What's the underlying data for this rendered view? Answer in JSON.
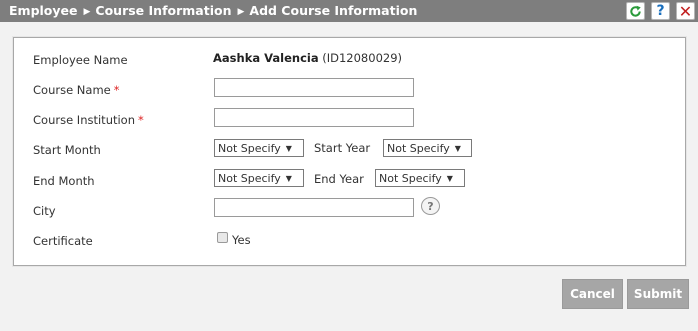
{
  "header": {
    "breadcrumb": [
      "Employee",
      "Course Information",
      "Add Course Information"
    ],
    "refresh_icon": "refresh-icon",
    "help_label": "?",
    "close_label": "✕"
  },
  "form": {
    "employee_name_label": "Employee Name",
    "employee_name": "Aashka Valencia",
    "employee_id": "(ID12080029)",
    "course_name_label": "Course Name",
    "course_name_value": "",
    "course_institution_label": "Course Institution",
    "course_institution_value": "",
    "required_marker": "*",
    "start_month_label": "Start Month",
    "start_month_value": "Not Specify",
    "start_year_label": "Start Year",
    "start_year_value": "Not Specify",
    "end_month_label": "End Month",
    "end_month_value": "Not Specify",
    "end_year_label": "End Year",
    "end_year_value": "Not Specify",
    "city_label": "City",
    "city_value": "",
    "city_help": "?",
    "certificate_label": "Certificate",
    "certificate_option": "Yes",
    "certificate_checked": false
  },
  "actions": {
    "cancel_label": "Cancel",
    "submit_label": "Submit"
  },
  "colors": {
    "titlebar": "#7e7e7e",
    "required": "#dd2222",
    "button": "#a6a6a6"
  }
}
